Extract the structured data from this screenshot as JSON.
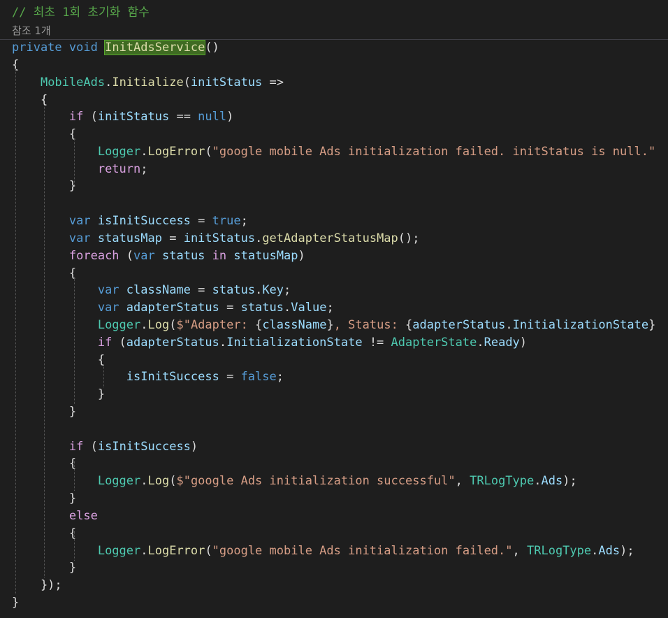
{
  "editor": {
    "codelens": "참조 1개",
    "colors": {
      "background": "#1e1e1e",
      "keyword": "#569cd6",
      "control": "#d8a0df",
      "identifier": "#9cdcfe",
      "type": "#4ec9b0",
      "method": "#dcdcaa",
      "string": "#d69d85",
      "comment": "#57a64a",
      "text": "#dcdcdc"
    },
    "lines": [
      {
        "kind": "code",
        "tokens": [
          {
            "t": "// 최초 1회 초기화 함수",
            "c": "comment"
          }
        ]
      },
      {
        "kind": "codelens"
      },
      {
        "kind": "code",
        "tokens": [
          {
            "t": "private",
            "c": "keyword"
          },
          {
            "t": " ",
            "c": "text"
          },
          {
            "t": "void",
            "c": "keyword"
          },
          {
            "t": " ",
            "c": "text"
          },
          {
            "t": "InitAdsService",
            "c": "method",
            "hl": true
          },
          {
            "t": "()",
            "c": "text"
          }
        ]
      },
      {
        "kind": "code",
        "tokens": [
          {
            "t": "{",
            "c": "text"
          }
        ]
      },
      {
        "kind": "code",
        "tokens": [
          {
            "t": "    ",
            "c": "text"
          },
          {
            "t": "MobileAds",
            "c": "type"
          },
          {
            "t": ".",
            "c": "text"
          },
          {
            "t": "Initialize",
            "c": "method"
          },
          {
            "t": "(",
            "c": "text"
          },
          {
            "t": "initStatus",
            "c": "identifier"
          },
          {
            "t": " =>",
            "c": "text"
          }
        ]
      },
      {
        "kind": "code",
        "tokens": [
          {
            "t": "    {",
            "c": "text"
          }
        ]
      },
      {
        "kind": "code",
        "tokens": [
          {
            "t": "        ",
            "c": "text"
          },
          {
            "t": "if",
            "c": "control"
          },
          {
            "t": " (",
            "c": "text"
          },
          {
            "t": "initStatus",
            "c": "identifier"
          },
          {
            "t": " == ",
            "c": "text"
          },
          {
            "t": "null",
            "c": "keyword"
          },
          {
            "t": ")",
            "c": "text"
          }
        ]
      },
      {
        "kind": "code",
        "tokens": [
          {
            "t": "        {",
            "c": "text"
          }
        ]
      },
      {
        "kind": "code",
        "tokens": [
          {
            "t": "            ",
            "c": "text"
          },
          {
            "t": "Logger",
            "c": "type"
          },
          {
            "t": ".",
            "c": "text"
          },
          {
            "t": "LogError",
            "c": "method"
          },
          {
            "t": "(",
            "c": "text"
          },
          {
            "t": "\"google mobile Ads initialization failed. initStatus is null.\"",
            "c": "string"
          }
        ]
      },
      {
        "kind": "code",
        "tokens": [
          {
            "t": "            ",
            "c": "text"
          },
          {
            "t": "return",
            "c": "control"
          },
          {
            "t": ";",
            "c": "text"
          }
        ]
      },
      {
        "kind": "code",
        "tokens": [
          {
            "t": "        }",
            "c": "text"
          }
        ]
      },
      {
        "kind": "code",
        "tokens": []
      },
      {
        "kind": "code",
        "tokens": [
          {
            "t": "        ",
            "c": "text"
          },
          {
            "t": "var",
            "c": "keyword"
          },
          {
            "t": " ",
            "c": "text"
          },
          {
            "t": "isInitSuccess",
            "c": "identifier"
          },
          {
            "t": " = ",
            "c": "text"
          },
          {
            "t": "true",
            "c": "keyword"
          },
          {
            "t": ";",
            "c": "text"
          }
        ]
      },
      {
        "kind": "code",
        "tokens": [
          {
            "t": "        ",
            "c": "text"
          },
          {
            "t": "var",
            "c": "keyword"
          },
          {
            "t": " ",
            "c": "text"
          },
          {
            "t": "statusMap",
            "c": "identifier"
          },
          {
            "t": " = ",
            "c": "text"
          },
          {
            "t": "initStatus",
            "c": "identifier"
          },
          {
            "t": ".",
            "c": "text"
          },
          {
            "t": "getAdapterStatusMap",
            "c": "method"
          },
          {
            "t": "();",
            "c": "text"
          }
        ]
      },
      {
        "kind": "code",
        "tokens": [
          {
            "t": "        ",
            "c": "text"
          },
          {
            "t": "foreach",
            "c": "control"
          },
          {
            "t": " (",
            "c": "text"
          },
          {
            "t": "var",
            "c": "keyword"
          },
          {
            "t": " ",
            "c": "text"
          },
          {
            "t": "status",
            "c": "identifier"
          },
          {
            "t": " ",
            "c": "text"
          },
          {
            "t": "in",
            "c": "control"
          },
          {
            "t": " ",
            "c": "text"
          },
          {
            "t": "statusMap",
            "c": "identifier"
          },
          {
            "t": ")",
            "c": "text"
          }
        ]
      },
      {
        "kind": "code",
        "tokens": [
          {
            "t": "        {",
            "c": "text"
          }
        ]
      },
      {
        "kind": "code",
        "tokens": [
          {
            "t": "            ",
            "c": "text"
          },
          {
            "t": "var",
            "c": "keyword"
          },
          {
            "t": " ",
            "c": "text"
          },
          {
            "t": "className",
            "c": "identifier"
          },
          {
            "t": " = ",
            "c": "text"
          },
          {
            "t": "status",
            "c": "identifier"
          },
          {
            "t": ".",
            "c": "text"
          },
          {
            "t": "Key",
            "c": "identifier"
          },
          {
            "t": ";",
            "c": "text"
          }
        ]
      },
      {
        "kind": "code",
        "tokens": [
          {
            "t": "            ",
            "c": "text"
          },
          {
            "t": "var",
            "c": "keyword"
          },
          {
            "t": " ",
            "c": "text"
          },
          {
            "t": "adapterStatus",
            "c": "identifier"
          },
          {
            "t": " = ",
            "c": "text"
          },
          {
            "t": "status",
            "c": "identifier"
          },
          {
            "t": ".",
            "c": "text"
          },
          {
            "t": "Value",
            "c": "identifier"
          },
          {
            "t": ";",
            "c": "text"
          }
        ]
      },
      {
        "kind": "code",
        "tokens": [
          {
            "t": "            ",
            "c": "text"
          },
          {
            "t": "Logger",
            "c": "type"
          },
          {
            "t": ".",
            "c": "text"
          },
          {
            "t": "Log",
            "c": "method"
          },
          {
            "t": "(",
            "c": "text"
          },
          {
            "t": "$\"Adapter: ",
            "c": "string"
          },
          {
            "t": "{",
            "c": "text"
          },
          {
            "t": "className",
            "c": "identifier"
          },
          {
            "t": "}",
            "c": "text"
          },
          {
            "t": ", Status: ",
            "c": "string"
          },
          {
            "t": "{",
            "c": "text"
          },
          {
            "t": "adapterStatus",
            "c": "identifier"
          },
          {
            "t": ".",
            "c": "text"
          },
          {
            "t": "InitializationState",
            "c": "identifier"
          },
          {
            "t": "}",
            "c": "text"
          }
        ]
      },
      {
        "kind": "code",
        "tokens": [
          {
            "t": "            ",
            "c": "text"
          },
          {
            "t": "if",
            "c": "control"
          },
          {
            "t": " (",
            "c": "text"
          },
          {
            "t": "adapterStatus",
            "c": "identifier"
          },
          {
            "t": ".",
            "c": "text"
          },
          {
            "t": "InitializationState",
            "c": "identifier"
          },
          {
            "t": " != ",
            "c": "text"
          },
          {
            "t": "AdapterState",
            "c": "type"
          },
          {
            "t": ".",
            "c": "text"
          },
          {
            "t": "Ready",
            "c": "identifier"
          },
          {
            "t": ")",
            "c": "text"
          }
        ]
      },
      {
        "kind": "code",
        "tokens": [
          {
            "t": "            {",
            "c": "text"
          }
        ]
      },
      {
        "kind": "code",
        "tokens": [
          {
            "t": "                ",
            "c": "text"
          },
          {
            "t": "isInitSuccess",
            "c": "identifier"
          },
          {
            "t": " = ",
            "c": "text"
          },
          {
            "t": "false",
            "c": "keyword"
          },
          {
            "t": ";",
            "c": "text"
          }
        ]
      },
      {
        "kind": "code",
        "tokens": [
          {
            "t": "            }",
            "c": "text"
          }
        ]
      },
      {
        "kind": "code",
        "tokens": [
          {
            "t": "        }",
            "c": "text"
          }
        ]
      },
      {
        "kind": "code",
        "tokens": []
      },
      {
        "kind": "code",
        "tokens": [
          {
            "t": "        ",
            "c": "text"
          },
          {
            "t": "if",
            "c": "control"
          },
          {
            "t": " (",
            "c": "text"
          },
          {
            "t": "isInitSuccess",
            "c": "identifier"
          },
          {
            "t": ")",
            "c": "text"
          }
        ]
      },
      {
        "kind": "code",
        "tokens": [
          {
            "t": "        {",
            "c": "text"
          }
        ]
      },
      {
        "kind": "code",
        "tokens": [
          {
            "t": "            ",
            "c": "text"
          },
          {
            "t": "Logger",
            "c": "type"
          },
          {
            "t": ".",
            "c": "text"
          },
          {
            "t": "Log",
            "c": "method"
          },
          {
            "t": "(",
            "c": "text"
          },
          {
            "t": "$\"google Ads initialization successful\"",
            "c": "string"
          },
          {
            "t": ", ",
            "c": "text"
          },
          {
            "t": "TRLogType",
            "c": "type"
          },
          {
            "t": ".",
            "c": "text"
          },
          {
            "t": "Ads",
            "c": "identifier"
          },
          {
            "t": ");",
            "c": "text"
          }
        ]
      },
      {
        "kind": "code",
        "tokens": [
          {
            "t": "        }",
            "c": "text"
          }
        ]
      },
      {
        "kind": "code",
        "tokens": [
          {
            "t": "        ",
            "c": "text"
          },
          {
            "t": "else",
            "c": "control"
          }
        ]
      },
      {
        "kind": "code",
        "tokens": [
          {
            "t": "        {",
            "c": "text"
          }
        ]
      },
      {
        "kind": "code",
        "tokens": [
          {
            "t": "            ",
            "c": "text"
          },
          {
            "t": "Logger",
            "c": "type"
          },
          {
            "t": ".",
            "c": "text"
          },
          {
            "t": "LogError",
            "c": "method"
          },
          {
            "t": "(",
            "c": "text"
          },
          {
            "t": "\"google mobile Ads initialization failed.\"",
            "c": "string"
          },
          {
            "t": ", ",
            "c": "text"
          },
          {
            "t": "TRLogType",
            "c": "type"
          },
          {
            "t": ".",
            "c": "text"
          },
          {
            "t": "Ads",
            "c": "identifier"
          },
          {
            "t": ");",
            "c": "text"
          }
        ]
      },
      {
        "kind": "code",
        "tokens": [
          {
            "t": "        }",
            "c": "text"
          }
        ]
      },
      {
        "kind": "code",
        "tokens": [
          {
            "t": "    });",
            "c": "text"
          }
        ]
      },
      {
        "kind": "code",
        "tokens": [
          {
            "t": "}",
            "c": "text"
          }
        ]
      }
    ]
  }
}
